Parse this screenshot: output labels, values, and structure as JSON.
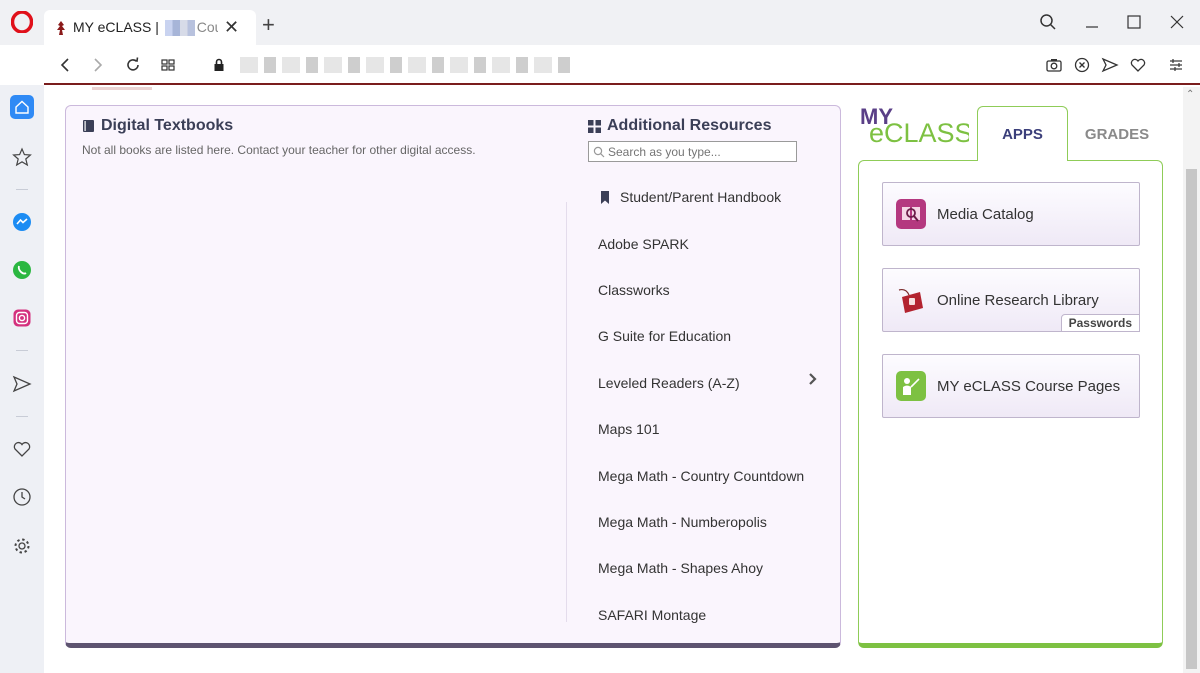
{
  "browser": {
    "tab_title_start": "MY eCLASS |",
    "tab_title_end": "Cou"
  },
  "left_panel": {
    "textbooks_title": "Digital Textbooks",
    "textbooks_note": "Not all books are listed here. Contact your teacher for other digital access.",
    "resources_title": "Additional Resources",
    "search_placeholder": "Search as you type...",
    "resources": [
      {
        "label": "Student/Parent Handbook",
        "icon": "bookmark-icon"
      },
      {
        "label": "Adobe SPARK"
      },
      {
        "label": "Classworks"
      },
      {
        "label": "G Suite for Education"
      },
      {
        "label": "Leveled Readers (A-Z)",
        "icon": "chevron-right-icon"
      },
      {
        "label": "Maps 101"
      },
      {
        "label": "Mega Math - Country Countdown"
      },
      {
        "label": "Mega Math - Numberopolis"
      },
      {
        "label": "Mega Math - Shapes Ahoy"
      },
      {
        "label": "SAFARI Montage"
      }
    ]
  },
  "right_panel": {
    "logo_top": "MY",
    "logo_bottom": "eCLASS",
    "tabs": {
      "apps": "APPS",
      "grades": "GRADES"
    },
    "apps": [
      {
        "label": "Media Catalog",
        "icon": "media-catalog-icon",
        "color": "#b4387f"
      },
      {
        "label": "Online Research Library",
        "icon": "research-library-icon",
        "color": "#b3232f",
        "tag": "Passwords"
      },
      {
        "label": "MY eCLASS Course Pages",
        "icon": "course-pages-icon",
        "color": "#7dc142"
      }
    ]
  },
  "colors": {
    "accent_purple": "#5d5370",
    "accent_green": "#7dc142",
    "accent_maroon": "#7a1d1d"
  }
}
